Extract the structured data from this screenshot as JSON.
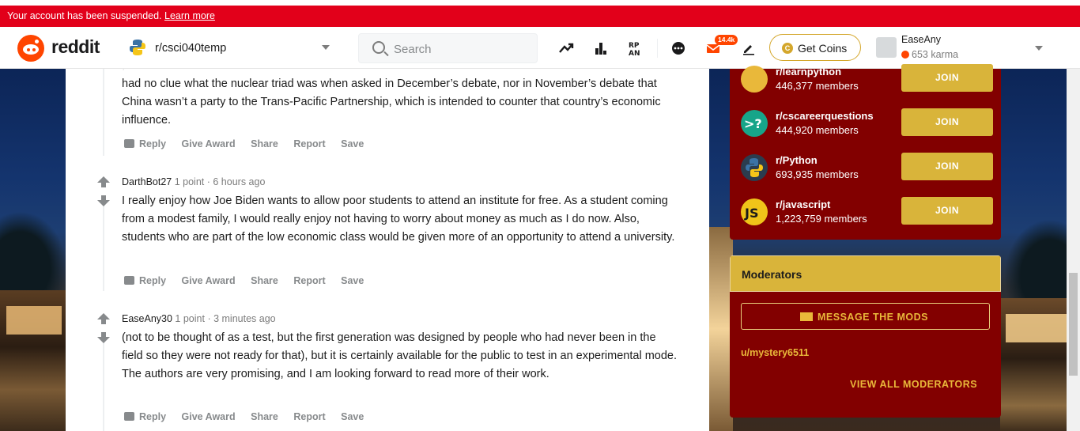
{
  "banner": {
    "text": "Your account has been suspended.",
    "link": "Learn more"
  },
  "header": {
    "wordmark": "reddit",
    "community": "r/csci040temp",
    "search_placeholder": "Search",
    "notification_badge": "14.4k",
    "coins_label": "Get Coins",
    "username": "EaseAny",
    "karma": "653 karma"
  },
  "comments": [
    {
      "body": "had no clue what the nuclear triad was when asked in December’s debate, nor in November’s debate that China wasn’t a party to the Trans-Pacific Partnership, which is intended to counter that country’s economic influence.",
      "actions": [
        "Reply",
        "Give Award",
        "Share",
        "Report",
        "Save"
      ]
    },
    {
      "author": "DarthBot27",
      "points": "1 point",
      "time": "· 6 hours ago",
      "body": "I really enjoy how Joe Biden wants to allow poor students to attend an institute for free. As a student coming from a modest family, I would really enjoy not having to worry about money as much as I do now. Also, students who are part of the low economic class would be given more of an opportunity to attend a university.",
      "actions": [
        "Reply",
        "Give Award",
        "Share",
        "Report",
        "Save"
      ]
    },
    {
      "author": "EaseAny30",
      "points": "1 point",
      "time": "· 3 minutes ago",
      "body": "(not to be thought of as a test, but the first generation was designed by people who had never been in the field so they were not ready for that), but it is certainly available for the public to test in an experimental mode. The authors are very promising, and I am looking forward to read more of their work.",
      "actions": [
        "Reply",
        "Give Award",
        "Share",
        "Report",
        "Save"
      ]
    }
  ],
  "sidebar": {
    "communities": [
      {
        "name": "r/learnpython",
        "members": "446,377 members",
        "join": "JOIN",
        "color": "#e9b83a"
      },
      {
        "name": "r/cscareerquestions",
        "members": "444,920 members",
        "join": "JOIN",
        "color": "#17a589"
      },
      {
        "name": "r/Python",
        "members": "693,935 members",
        "join": "JOIN",
        "color": "#3a5a78"
      },
      {
        "name": "r/javascript",
        "members": "1,223,759 members",
        "join": "JOIN",
        "color": "#f0c419"
      }
    ],
    "moderators": {
      "title": "Moderators",
      "message_button": "MESSAGE THE MODS",
      "mod": "u/mystery6511",
      "view_all": "VIEW ALL MODERATORS"
    }
  }
}
